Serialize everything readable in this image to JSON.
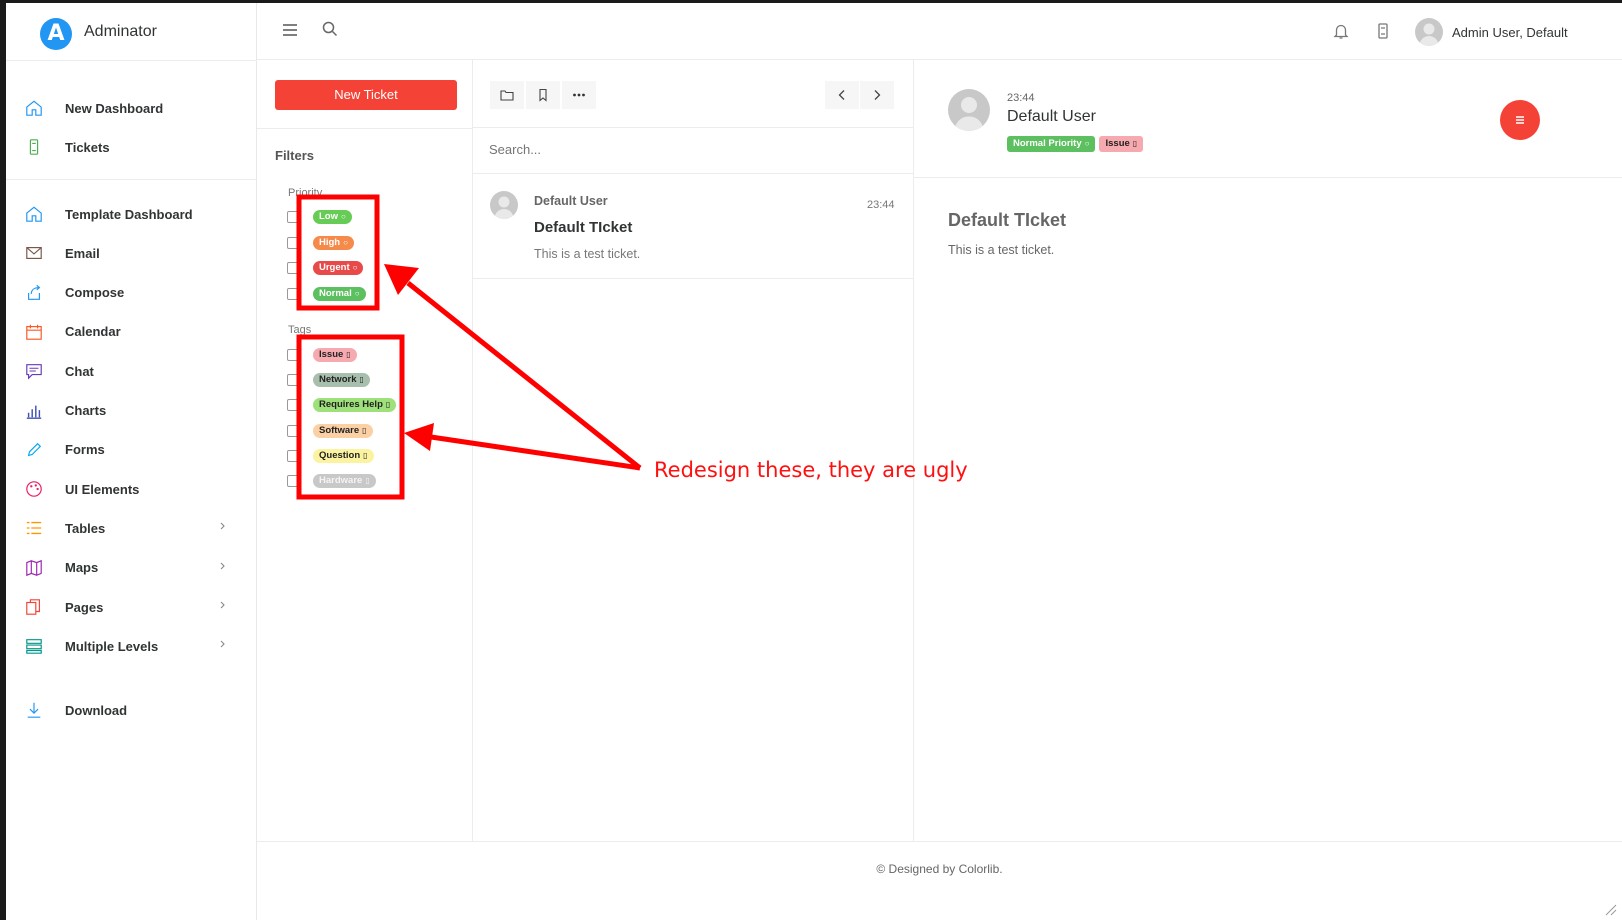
{
  "app": {
    "name": "Adminator",
    "logo_letter": "A"
  },
  "sidebar": {
    "group1": [
      {
        "label": "New Dashboard",
        "icon": "home-icon",
        "color": "#2196f3"
      },
      {
        "label": "Tickets",
        "icon": "ticket-icon",
        "color": "#4caf50"
      }
    ],
    "group2": [
      {
        "label": "Template Dashboard",
        "icon": "home-icon",
        "color": "#2196f3"
      },
      {
        "label": "Email",
        "icon": "mail-icon",
        "color": "#795548"
      },
      {
        "label": "Compose",
        "icon": "share-icon",
        "color": "#2196f3"
      },
      {
        "label": "Calendar",
        "icon": "calendar-icon",
        "color": "#ff5722"
      },
      {
        "label": "Chat",
        "icon": "chat-icon",
        "color": "#673ab7"
      },
      {
        "label": "Charts",
        "icon": "bar-chart-icon",
        "color": "#3f51b5"
      },
      {
        "label": "Forms",
        "icon": "pencil-icon",
        "color": "#03a9f4"
      },
      {
        "label": "UI Elements",
        "icon": "palette-icon",
        "color": "#e91e63"
      },
      {
        "label": "Tables",
        "icon": "list-icon",
        "color": "#ff9800"
      },
      {
        "label": "Maps",
        "icon": "map-icon",
        "color": "#9c27b0"
      },
      {
        "label": "Pages",
        "icon": "files-icon",
        "color": "#f44336"
      },
      {
        "label": "Multiple Levels",
        "icon": "rows-icon",
        "color": "#009688"
      }
    ],
    "group3": [
      {
        "label": "Download",
        "icon": "download-icon",
        "color": "#2196f3"
      }
    ]
  },
  "topbar": {
    "user_name": "Admin User, Default"
  },
  "filters": {
    "new_ticket_label": "New Ticket",
    "title": "Filters",
    "priority_label": "Priority",
    "priority": [
      {
        "label": "Low",
        "bg": "#66cc55",
        "fg": "#ffffff"
      },
      {
        "label": "High",
        "bg": "#f58a4b",
        "fg": "#ffffff"
      },
      {
        "label": "Urgent",
        "bg": "#e84a4a",
        "fg": "#ffffff"
      },
      {
        "label": "Normal",
        "bg": "#5cc060",
        "fg": "#ffffff"
      }
    ],
    "tags_label": "Tags",
    "tags": [
      {
        "label": "Issue",
        "bg": "#f7a9b0",
        "fg": "#222222"
      },
      {
        "label": "Network",
        "bg": "#a9bfad",
        "fg": "#222222"
      },
      {
        "label": "Requires Help",
        "bg": "#9ee07a",
        "fg": "#222222"
      },
      {
        "label": "Software",
        "bg": "#fbd0a4",
        "fg": "#222222"
      },
      {
        "label": "Question",
        "bg": "#fbf3a0",
        "fg": "#222222"
      },
      {
        "label": "Hardware",
        "bg": "#c8c8c8",
        "fg": "#f4f4f4"
      }
    ]
  },
  "list": {
    "search_placeholder": "Search...",
    "tickets": [
      {
        "user": "Default User",
        "time": "23:44",
        "title": "Default TIcket",
        "body": "This is a test ticket."
      }
    ]
  },
  "detail": {
    "time": "23:44",
    "user": "Default User",
    "badges": [
      {
        "label": "Normal Priority",
        "bg": "#5cc060",
        "fg": "#ffffff"
      },
      {
        "label": "Issue",
        "bg": "#f7a9b0",
        "fg": "#222222"
      }
    ],
    "title": "Default TIcket",
    "body": "This is a test ticket."
  },
  "footer": {
    "text": "© Designed by Colorlib."
  },
  "annotation": {
    "text": "Redesign these, they are ugly",
    "color": "#ff1010"
  }
}
